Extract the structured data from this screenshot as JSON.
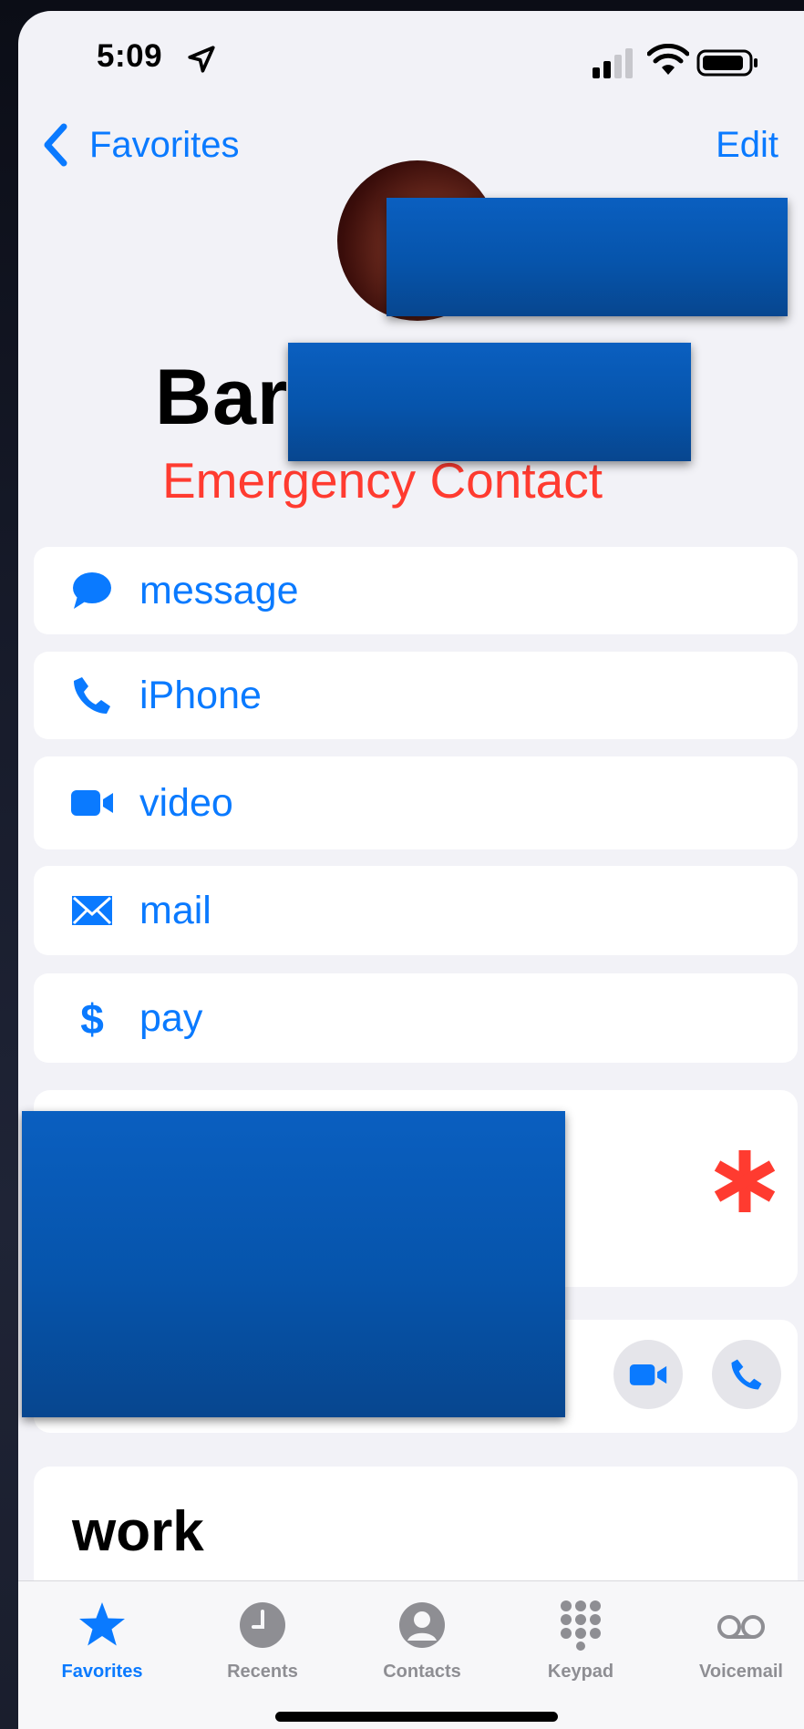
{
  "status_bar": {
    "time": "5:09",
    "icons": [
      "location-arrow-icon",
      "cellular-signal-icon",
      "wifi-icon",
      "battery-icon"
    ]
  },
  "nav": {
    "back_label": "Favorites",
    "edit_label": "Edit"
  },
  "contact": {
    "name_visible": "Bar",
    "status": "Emergency Contact"
  },
  "actions": [
    {
      "label": "message",
      "icon": "message-bubble-icon"
    },
    {
      "label": "iPhone",
      "icon": "phone-icon"
    },
    {
      "label": "video",
      "icon": "video-camera-icon"
    },
    {
      "label": "mail",
      "icon": "envelope-icon"
    },
    {
      "label": "pay",
      "icon": "dollar-icon"
    }
  ],
  "cards": {
    "emergency_marker_icon": "asterisk-icon",
    "facetime_buttons": [
      "video-camera-icon",
      "phone-icon"
    ],
    "work_label": "work"
  },
  "tabbar": [
    {
      "label": "Favorites",
      "icon": "star-icon",
      "active": true
    },
    {
      "label": "Recents",
      "icon": "clock-icon",
      "active": false
    },
    {
      "label": "Contacts",
      "icon": "person-circle-icon",
      "active": false
    },
    {
      "label": "Keypad",
      "icon": "keypad-icon",
      "active": false
    },
    {
      "label": "Voicemail",
      "icon": "voicemail-icon",
      "active": false
    }
  ],
  "colors": {
    "accent": "#0a7aff",
    "danger": "#ff3b30",
    "background": "#f2f2f7",
    "redaction": "#0654ab"
  }
}
